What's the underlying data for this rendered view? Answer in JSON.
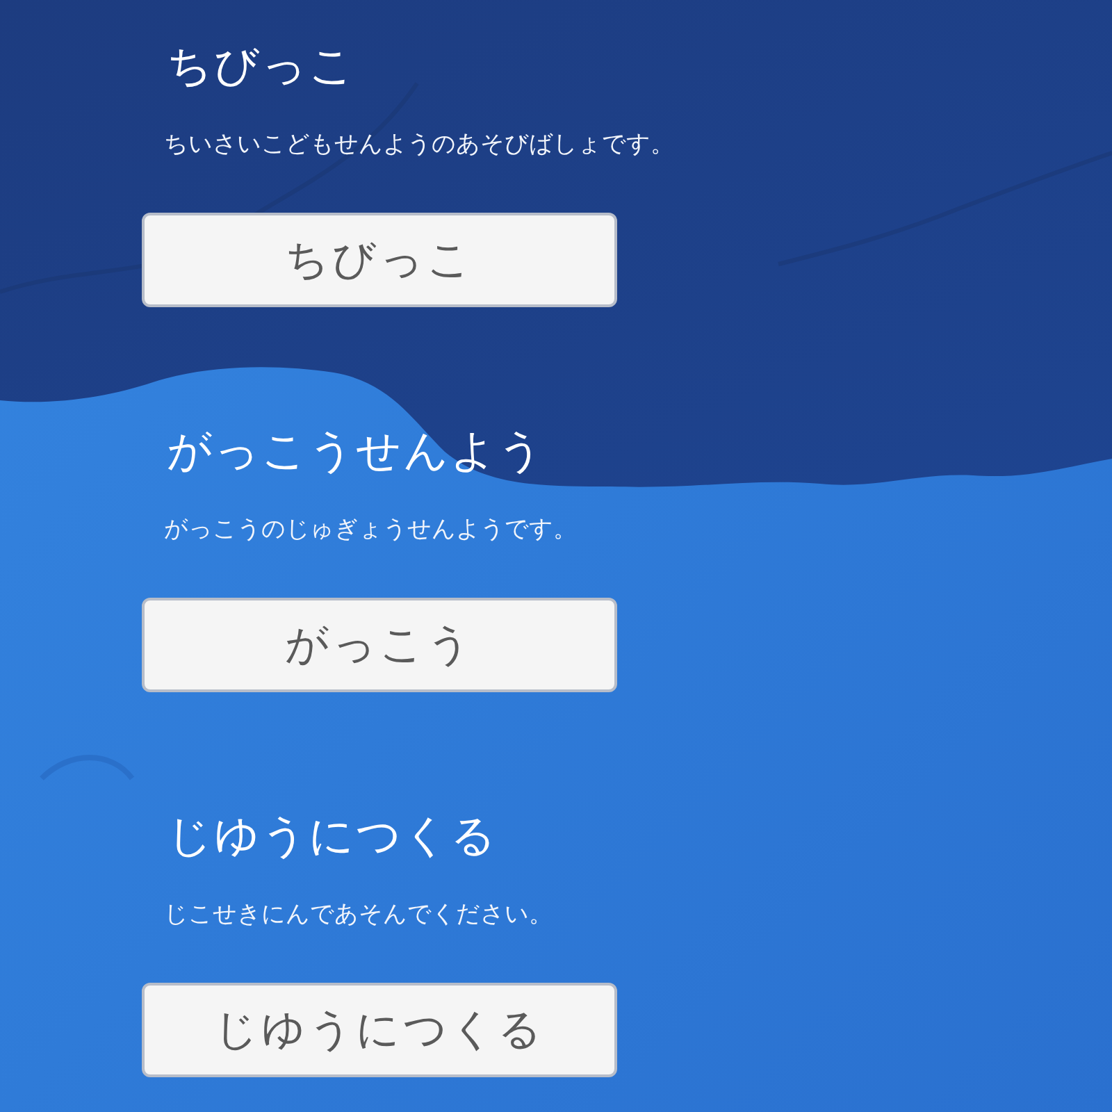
{
  "sections": [
    {
      "title": "ちびっこ",
      "description": "ちいさいこどもせんようのあそびばしょです。",
      "button": "ちびっこ"
    },
    {
      "title": "がっこうせんよう",
      "description": "がっこうのじゅぎょうせんようです。",
      "button": "がっこう"
    },
    {
      "title": "じゆうにつくる",
      "description": "じこせきにんであそんでください。",
      "button": "じゆうにつくる"
    }
  ]
}
